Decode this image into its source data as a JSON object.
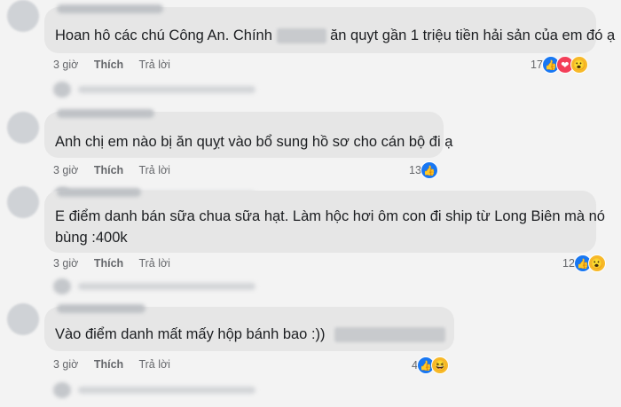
{
  "comments": [
    {
      "text_before": "Hoan hô các chú Công An. Chính ",
      "text_after": "ăn quyt gần 1 triệu tiền hải sản của em đó ạ",
      "time": "3 giờ",
      "like": "Thích",
      "reply": "Trả lời",
      "reaction_count": "17",
      "reactions": [
        "like-icon",
        "love-icon",
        "wow-icon"
      ]
    },
    {
      "text": "Anh chị em nào bị ăn quỵt vào bổ sung hồ sơ cho cán bộ đi ạ",
      "time": "3 giờ",
      "like": "Thích",
      "reply": "Trả lời",
      "reaction_count": "13",
      "reactions": [
        "like-icon"
      ]
    },
    {
      "line1": "E điểm danh bán sữa chua sữa hạt. Làm hộc hơi ôm con đi ship từ Long Biên mà nó",
      "line2": "bùng :400k",
      "time": "3 giờ",
      "like": "Thích",
      "reply": "Trả lời",
      "reaction_count": "12",
      "reactions": [
        "like-icon",
        "wow-icon"
      ]
    },
    {
      "text": "Vào điểm danh mất mấy hộp bánh bao :))",
      "time": "3 giờ",
      "like": "Thích",
      "reply": "Trả lời",
      "reaction_count": "4",
      "reactions": [
        "like-icon",
        "haha-icon"
      ]
    }
  ],
  "colors": {
    "bubble": "#e6e6e6",
    "like": "#1877f2",
    "love": "#f33e58",
    "wow": "#f7b928"
  }
}
